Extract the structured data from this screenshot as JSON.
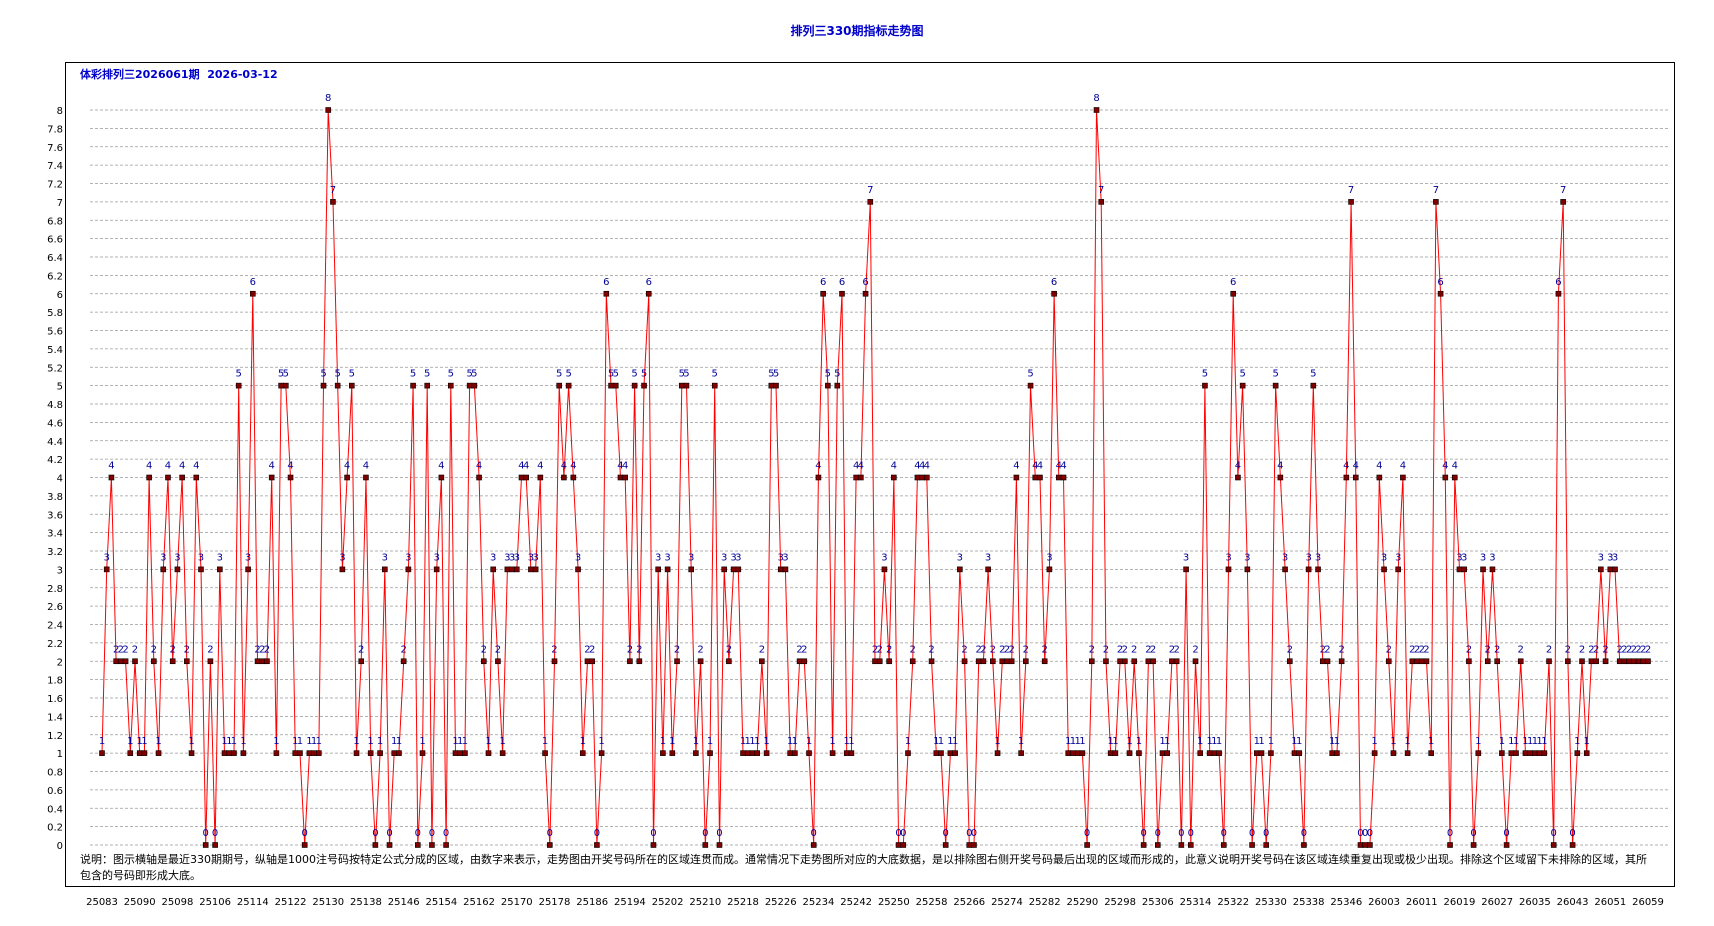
{
  "title": "排列三330期指标走势图",
  "issue_info": "体彩排列三2026061期  2026-03-12",
  "note": "说明：图示横轴是最近330期期号，纵轴是1000注号码按特定公式分成的区域，由数字来表示，走势图由开奖号码所在的区域连贯而成。通常情况下走势图所对应的大底数据，是以排除图右侧开奖号码最后出现的区域而形成的，此意义说明开奖号码在该区域连续重复出现或极少出现。排除这个区域留下未排除的区域，其所包含的号码即形成大底。",
  "colors": {
    "title": "#0000cc",
    "line": "#ff0000",
    "marker": "#800000",
    "label": "#000099",
    "grid": "#999999"
  },
  "chart_data": {
    "type": "line",
    "title": "排列三330期指标走势图",
    "ylim": [
      0,
      8
    ],
    "y_ticks": [
      0,
      0.2,
      0.4,
      0.6,
      0.8,
      1,
      1.2,
      1.4,
      1.6,
      1.8,
      2,
      2.2,
      2.4,
      2.6,
      2.8,
      3,
      3.2,
      3.4,
      3.6,
      3.8,
      4,
      4.2,
      4.4,
      4.6,
      4.8,
      5,
      5.2,
      5.4,
      5.6,
      5.8,
      6,
      6.2,
      6.4,
      6.6,
      6.8,
      7,
      7.2,
      7.4,
      7.6,
      7.8,
      8
    ],
    "x_tick_labels": [
      "25083",
      "25090",
      "25098",
      "25106",
      "25114",
      "25122",
      "25130",
      "25138",
      "25146",
      "25154",
      "25162",
      "25170",
      "25178",
      "25186",
      "25194",
      "25202",
      "25210",
      "25218",
      "25226",
      "25234",
      "25242",
      "25250",
      "25258",
      "25266",
      "25274",
      "25282",
      "25290",
      "25298",
      "25306",
      "25314",
      "25322",
      "25330",
      "25338",
      "25346",
      "26003",
      "26011",
      "26019",
      "26027",
      "26035",
      "26043",
      "26051",
      "26059"
    ],
    "grid": "dashed horizontal",
    "series": [
      {
        "values": [
          1,
          3,
          4,
          2,
          2,
          2,
          1,
          2,
          1,
          1,
          4,
          2,
          1,
          3,
          4,
          2,
          3,
          4,
          2,
          1,
          4,
          3,
          0,
          2,
          0,
          3,
          1,
          1,
          1,
          5,
          1,
          3,
          6,
          2,
          2,
          2,
          4,
          1,
          5,
          5,
          4,
          1,
          1,
          0,
          1,
          1,
          1,
          5,
          8,
          7,
          5,
          3,
          4,
          5,
          1,
          2,
          4,
          1,
          0,
          1,
          3,
          0,
          1,
          1,
          2,
          3,
          5,
          0,
          1,
          5,
          0,
          3,
          4,
          0,
          5,
          1,
          1,
          1,
          5,
          5,
          4,
          2,
          1,
          3,
          2,
          1,
          3,
          3,
          3,
          4,
          4,
          3,
          3,
          4,
          1,
          0,
          2,
          5,
          4,
          5,
          4,
          3,
          1,
          2,
          2,
          0,
          1,
          6,
          5,
          5,
          4,
          4,
          2,
          5,
          2,
          5,
          6,
          0,
          3,
          1,
          3,
          1,
          2,
          5,
          5,
          3,
          1,
          2,
          0,
          1,
          5,
          0,
          3,
          2,
          3,
          3,
          1,
          1,
          1,
          1,
          2,
          1,
          5,
          5,
          3,
          3,
          1,
          1,
          2,
          2,
          1,
          0,
          4,
          6,
          5,
          1,
          5,
          6,
          1,
          1,
          4,
          4,
          6,
          7,
          2,
          2,
          3,
          2,
          4,
          0,
          0,
          1,
          2,
          4,
          4,
          4,
          2,
          1,
          1,
          0,
          1,
          1,
          3,
          2,
          0,
          0,
          2,
          2,
          3,
          2,
          1,
          2,
          2,
          2,
          4,
          1,
          2,
          5,
          4,
          4,
          2,
          3,
          6,
          4,
          4,
          1,
          1,
          1,
          1,
          0,
          2,
          8,
          7,
          2,
          1,
          1,
          2,
          2,
          1,
          2,
          1,
          0,
          2,
          2,
          0,
          1,
          1,
          2,
          2,
          0,
          3,
          0,
          2,
          1,
          5,
          1,
          1,
          1,
          0,
          3,
          6,
          4,
          5,
          3,
          0,
          1,
          1,
          0,
          1,
          5,
          4,
          3,
          2,
          1,
          1,
          0,
          3,
          5,
          3,
          2,
          2,
          1,
          1,
          2,
          4,
          7,
          4,
          0,
          0,
          0,
          1,
          4,
          3,
          2,
          1,
          3,
          4,
          1,
          2,
          2,
          2,
          2,
          1,
          7,
          6,
          4,
          0,
          4,
          3,
          3,
          2,
          0,
          1,
          3,
          2,
          3,
          2,
          1,
          0,
          1,
          1,
          2,
          1,
          1,
          1,
          1,
          1,
          2,
          0,
          6,
          7,
          2,
          0,
          1,
          2,
          1,
          2,
          2,
          3,
          2,
          3,
          3,
          2,
          2,
          2,
          2,
          2,
          2,
          2
        ]
      }
    ]
  }
}
